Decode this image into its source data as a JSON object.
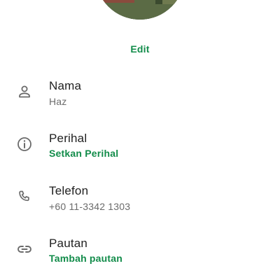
{
  "edit_label": "Edit",
  "colors": {
    "accent": "#128c4a",
    "icon": "#6b6b6b",
    "title": "#1f1f1f",
    "muted": "#6b6b6b"
  },
  "fields": [
    {
      "icon": "person-icon",
      "label": "Nama",
      "value": "Haz"
    },
    {
      "icon": "info-icon",
      "label": "Perihal",
      "value": "Setkan Perihal"
    },
    {
      "icon": "phone-icon",
      "label": "Telefon",
      "value": "+60 11-3342 1303"
    },
    {
      "icon": "link-icon",
      "label": "Pautan",
      "value": "Tambah pautan"
    }
  ]
}
